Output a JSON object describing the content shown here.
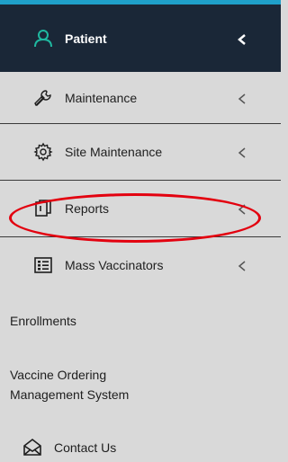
{
  "nav": {
    "patient": {
      "label": "Patient",
      "icon": "user-icon",
      "chevron": "chevron-left-icon"
    },
    "maintenance": {
      "label": "Maintenance",
      "icon": "wrench-icon",
      "chevron": "chevron-left-icon"
    },
    "site_maintenance": {
      "label": "Site Maintenance",
      "icon": "gear-icon",
      "chevron": "chevron-left-icon"
    },
    "reports": {
      "label": "Reports",
      "icon": "copy-icon",
      "chevron": "chevron-left-icon"
    },
    "mass_vaccinators": {
      "label": "Mass Vaccinators",
      "icon": "list-icon",
      "chevron": "chevron-left-icon"
    },
    "enrollments": {
      "label": "Enrollments"
    },
    "vaccine_ordering": {
      "label": "Vaccine Ordering Management System"
    },
    "contact_us": {
      "label": "Contact Us",
      "icon": "envelope-icon"
    }
  },
  "colors": {
    "active_bg": "#1a2737",
    "accent": "#1fa0c9",
    "menu_bg": "#d9d9d9",
    "highlight": "#e3000f"
  }
}
